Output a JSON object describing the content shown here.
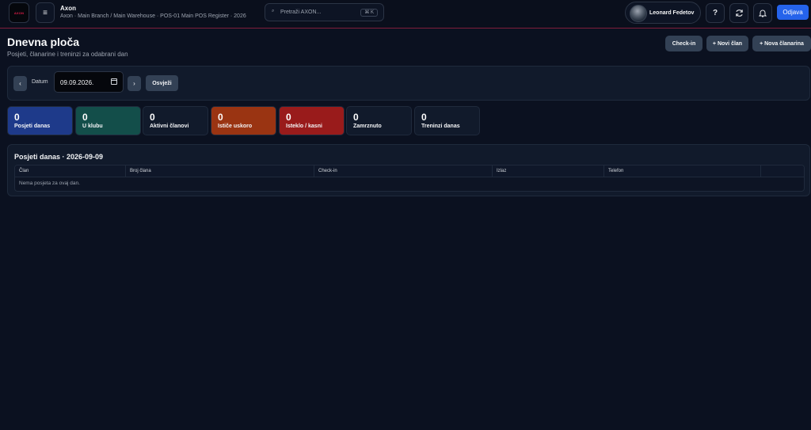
{
  "header": {
    "logo_text": "AXON",
    "app_title": "Axon",
    "breadcrumb": "Axon · Main Branch / Main Warehouse · POS-01 Main POS Register · 2026",
    "search_placeholder": "Pretraži AXON...",
    "search_shortcut": "⌘ K",
    "user_name": "Leonard Fedetov",
    "help_label": "?",
    "logout_label": "Odjava"
  },
  "page": {
    "title": "Dnevna ploča",
    "subtitle": "Posjeti, članarine i treninzi za odabrani dan",
    "actions": {
      "checkin": "Check-in",
      "new_member": "+ Novi član",
      "new_membership": "+ Nova članarina"
    }
  },
  "date_bar": {
    "prev": "‹",
    "next": "›",
    "label": "Datum",
    "value": "09.09.2026.",
    "refresh": "Osvježi"
  },
  "stats": [
    {
      "value": "0",
      "label": "Posjeti danas",
      "color": "#1e3a8a"
    },
    {
      "value": "0",
      "label": "U klubu",
      "color": "#134e4a"
    },
    {
      "value": "0",
      "label": "Aktivni članovi",
      "color": "#111a2b"
    },
    {
      "value": "0",
      "label": "Ističe uskoro",
      "color": "#9a3412"
    },
    {
      "value": "0",
      "label": "Isteklo / kasni",
      "color": "#991b1b"
    },
    {
      "value": "0",
      "label": "Zamrznuto",
      "color": "#111a2b"
    },
    {
      "value": "0",
      "label": "Treninzi danas",
      "color": "#111a2b"
    }
  ],
  "visits_table": {
    "title": "Posjeti danas · 2026-09-09",
    "columns": [
      "Član",
      "Broj člana",
      "Check-in",
      "Izlaz",
      "Telefon",
      ""
    ],
    "empty_text": "Nema posjeta za ovaj dan."
  }
}
